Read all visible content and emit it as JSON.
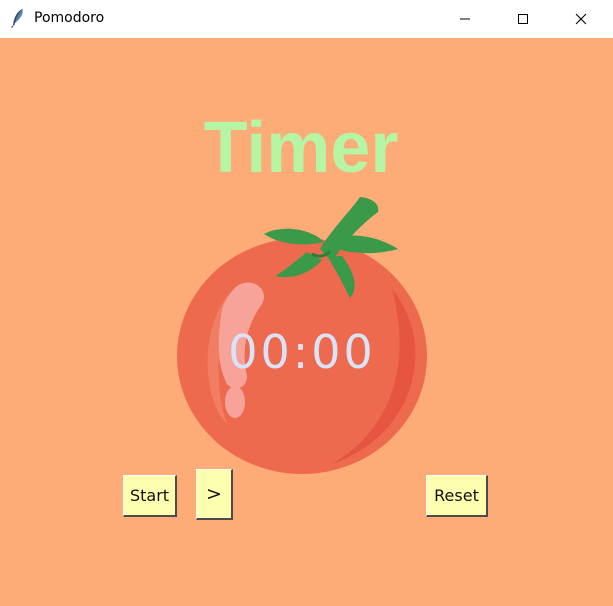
{
  "window": {
    "title": "Pomodoro",
    "app_icon": "feather-icon",
    "controls": [
      "minimize-icon",
      "maximize-icon",
      "close-icon"
    ]
  },
  "colors": {
    "background": "#fdac77",
    "heading": "#b5f5a3",
    "countdown": "#d9e3f7",
    "button_face": "#fefeb0",
    "tomato_body": "#f0624a",
    "leaf": "#3a9a4a"
  },
  "main": {
    "heading": "Timer",
    "countdown": "00:00",
    "image": "tomato-image"
  },
  "buttons": {
    "start_label": "Start",
    "next_label": ">",
    "reset_label": "Reset"
  }
}
